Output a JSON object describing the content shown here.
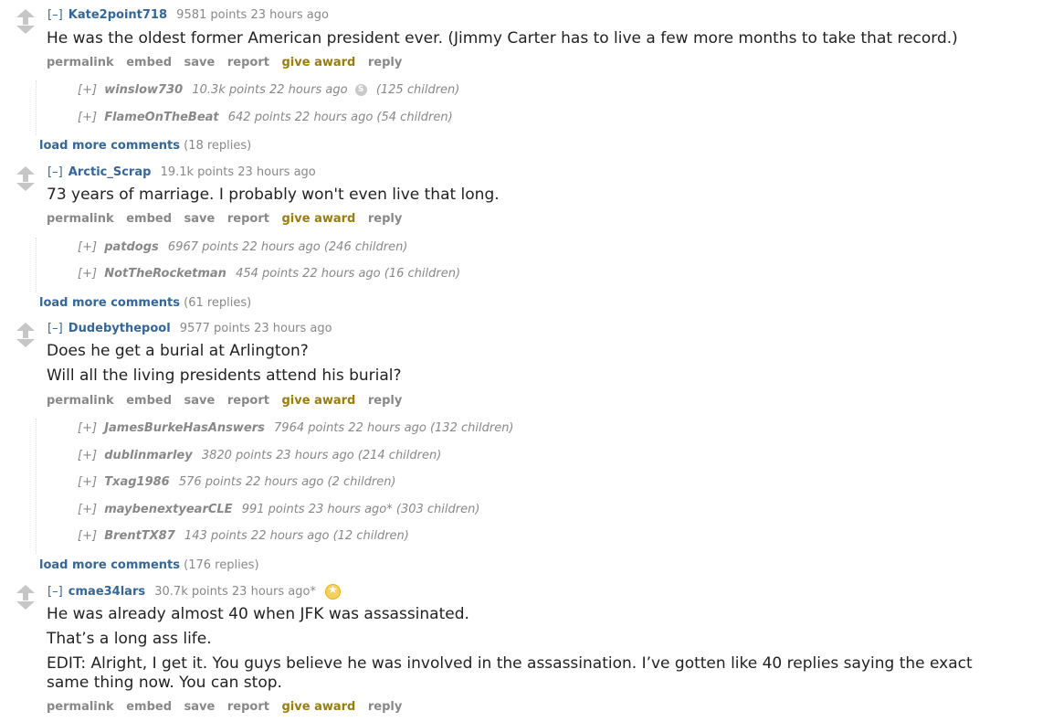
{
  "comments": [
    {
      "toggle": "[–]",
      "author": "Kate2point718",
      "score": "9581 points 23 hours ago",
      "body": [
        "He was the oldest former American president ever. (Jimmy Carter has to live a few more months to take that record.)"
      ],
      "buttons": [
        "permalink",
        "embed",
        "save",
        "report",
        "give award",
        "reply"
      ],
      "children": [
        {
          "toggle": "[+]",
          "author": "winslow730",
          "meta": "10.3k points 22 hours ago",
          "award": "S",
          "count": "(125 children)"
        },
        {
          "toggle": "[+]",
          "author": "FlameOnTheBeat",
          "meta": "642 points 22 hours ago (54 children)"
        }
      ],
      "load_more": "load more comments",
      "replies": "(18 replies)"
    },
    {
      "toggle": "[–]",
      "author": "Arctic_Scrap",
      "score": "19.1k points 23 hours ago",
      "body": [
        "73 years of marriage. I probably won't even live that long."
      ],
      "buttons": [
        "permalink",
        "embed",
        "save",
        "report",
        "give award",
        "reply"
      ],
      "children": [
        {
          "toggle": "[+]",
          "author": "patdogs",
          "meta": "6967 points 22 hours ago (246 children)"
        },
        {
          "toggle": "[+]",
          "author": "NotTheRocketman",
          "meta": "454 points 22 hours ago (16 children)"
        }
      ],
      "load_more": "load more comments",
      "replies": "(61 replies)"
    },
    {
      "toggle": "[–]",
      "author": "Dudebythepool",
      "score": "9577 points 23 hours ago",
      "body": [
        "Does he get a burial at Arlington?",
        "Will all the living presidents attend his burial?"
      ],
      "buttons": [
        "permalink",
        "embed",
        "save",
        "report",
        "give award",
        "reply"
      ],
      "children": [
        {
          "toggle": "[+]",
          "author": "JamesBurkeHasAnswers",
          "meta": "7964 points 22 hours ago (132 children)"
        },
        {
          "toggle": "[+]",
          "author": "dublinmarley",
          "meta": "3820 points 23 hours ago (214 children)"
        },
        {
          "toggle": "[+]",
          "author": "Txag1986",
          "meta": "576 points 22 hours ago (2 children)"
        },
        {
          "toggle": "[+]",
          "author": "maybenextyearCLE",
          "meta": "991 points 23 hours ago* (303 children)"
        },
        {
          "toggle": "[+]",
          "author": "BrentTX87",
          "meta": "143 points 22 hours ago (12 children)"
        }
      ],
      "load_more": "load more comments",
      "replies": "(176 replies)"
    },
    {
      "toggle": "[–]",
      "author": "cmae34lars",
      "score": "30.7k points 23 hours ago*",
      "body": [
        "He was already almost 40 when JFK was assassinated.",
        "That’s a long ass life.",
        "EDIT: Alright, I get it. You guys believe he was involved in the assassination. I’ve gotten like 40 replies saying the exact same thing now. You can stop."
      ],
      "buttons": [
        "permalink",
        "embed",
        "save",
        "report",
        "give award",
        "reply"
      ]
    }
  ],
  "colors": {
    "link": "#336699",
    "award": "#9a7d0a",
    "muted": "#888888"
  }
}
